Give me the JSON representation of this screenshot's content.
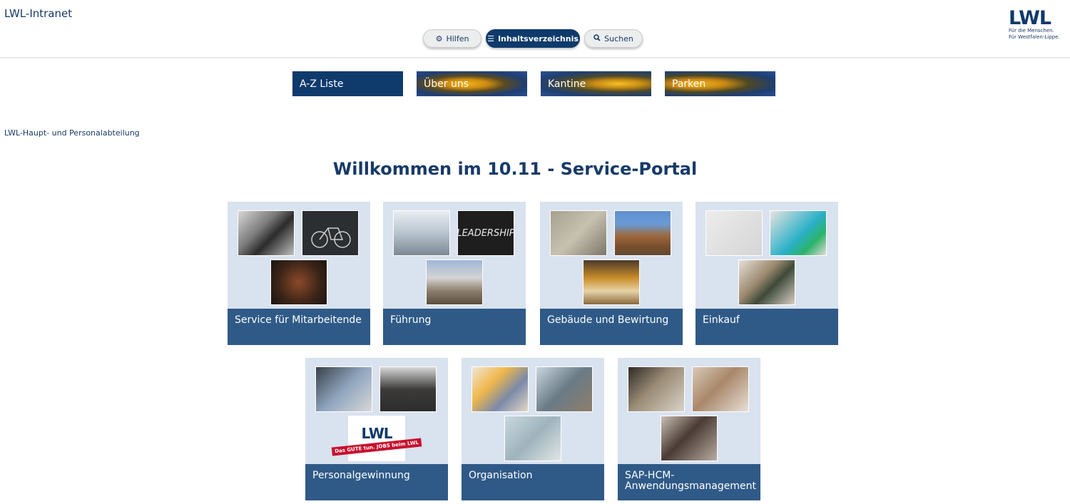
{
  "header": {
    "site_title": "LWL-Intranet",
    "buttons": {
      "help": {
        "label": "Hilfen",
        "icon": "gear-icon"
      },
      "index": {
        "label": "Inhaltsverzeichnis",
        "icon": "menu-icon"
      },
      "search": {
        "label": "Suchen",
        "icon": "search-icon"
      }
    },
    "logo": {
      "word": "LWL",
      "line1": "Für die Menschen.",
      "line2": "Für Westfalen-Lippe."
    }
  },
  "quicklinks": [
    {
      "label": "A-Z Liste"
    },
    {
      "label": "Über uns"
    },
    {
      "label": "Kantine"
    },
    {
      "label": "Parken"
    }
  ],
  "breadcrumb": "LWL-Haupt- und Personalabteilung",
  "page_title": "Willkommen im 10.11 - Service-Portal",
  "tiles": [
    {
      "label": "Service für Mitarbeitende"
    },
    {
      "label": "Führung",
      "image_text": "LEADERSHIP"
    },
    {
      "label": "Gebäude und Bewirtung"
    },
    {
      "label": "Einkauf"
    },
    {
      "label": "Personalgewinnung",
      "logo_word": "LWL",
      "logo_band": "Das GUTE tun. JOBS beim LWL"
    },
    {
      "label": "Organisation"
    },
    {
      "label": "SAP-HCM-Anwendungsmanagement"
    }
  ],
  "colors": {
    "navy": "#0f3a6c",
    "tile_caption": "#2f5a87",
    "tile_background": "#d9e2ef"
  }
}
